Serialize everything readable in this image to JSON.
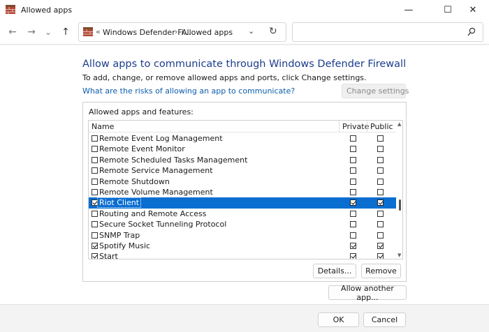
{
  "window": {
    "title": "Allowed apps",
    "minimize_glyph": "—",
    "maximize_glyph": "☐",
    "close_glyph": "✕"
  },
  "nav": {
    "back_glyph": "←",
    "forward_glyph": "→",
    "history_glyph": "⌄",
    "up_glyph": "↑",
    "address": {
      "sep1": "«",
      "crumb1": "Windows Defender Fi...",
      "sep2": "›",
      "crumb2": "Allowed apps",
      "dropdown_glyph": "⌄",
      "refresh_glyph": "↻"
    },
    "search": {
      "value": "",
      "placeholder": ""
    }
  },
  "main": {
    "heading": "Allow apps to communicate through Windows Defender Firewall",
    "subtext": "To add, change, or remove allowed apps and ports, click Change settings.",
    "risk_link": "What are the risks of allowing an app to communicate?",
    "change_settings_label": "Change settings",
    "group_label": "Allowed apps and features:",
    "columns": {
      "name": "Name",
      "private": "Private",
      "public": "Public"
    },
    "rows": [
      {
        "name": "Remote Event Log Management",
        "enabled": false,
        "private": false,
        "public": false,
        "selected": false
      },
      {
        "name": "Remote Event Monitor",
        "enabled": false,
        "private": false,
        "public": false,
        "selected": false
      },
      {
        "name": "Remote Scheduled Tasks Management",
        "enabled": false,
        "private": false,
        "public": false,
        "selected": false
      },
      {
        "name": "Remote Service Management",
        "enabled": false,
        "private": false,
        "public": false,
        "selected": false
      },
      {
        "name": "Remote Shutdown",
        "enabled": false,
        "private": false,
        "public": false,
        "selected": false
      },
      {
        "name": "Remote Volume Management",
        "enabled": false,
        "private": false,
        "public": false,
        "selected": false
      },
      {
        "name": "Riot Client",
        "enabled": true,
        "private": true,
        "public": true,
        "selected": true
      },
      {
        "name": "Routing and Remote Access",
        "enabled": false,
        "private": false,
        "public": false,
        "selected": false
      },
      {
        "name": "Secure Socket Tunneling Protocol",
        "enabled": false,
        "private": false,
        "public": false,
        "selected": false
      },
      {
        "name": "SNMP Trap",
        "enabled": false,
        "private": false,
        "public": false,
        "selected": false
      },
      {
        "name": "Spotify Music",
        "enabled": true,
        "private": true,
        "public": true,
        "selected": false
      },
      {
        "name": "Start",
        "enabled": true,
        "private": true,
        "public": true,
        "selected": false
      }
    ],
    "details_label": "Details...",
    "remove_label": "Remove",
    "allow_another_label": "Allow another app..."
  },
  "footer": {
    "ok_label": "OK",
    "cancel_label": "Cancel"
  },
  "colors": {
    "heading": "#1c3c8c",
    "link": "#0b5cad",
    "selection": "#0a6ed1"
  },
  "icons": [
    "firewall-brick-icon",
    "shield-icon",
    "search-icon"
  ]
}
